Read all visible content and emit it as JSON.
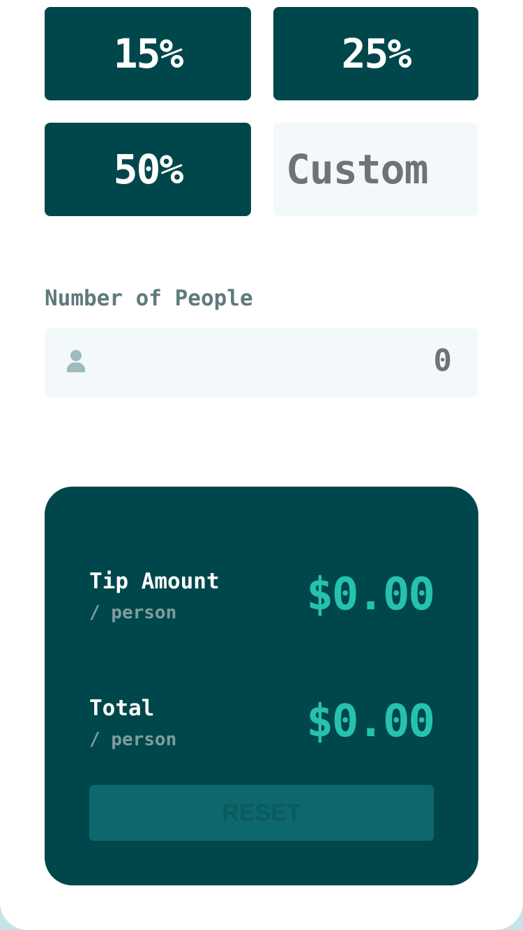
{
  "tips": {
    "options": [
      "15%",
      "25%",
      "50%"
    ],
    "custom_placeholder": "Custom"
  },
  "people": {
    "label": "Number of People",
    "value": "0",
    "icon": "person-icon"
  },
  "result": {
    "tip_label": "Tip Amount",
    "tip_sub": "/ person",
    "tip_value": "$0.00",
    "total_label": "Total",
    "total_sub": "/ person",
    "total_value": "$0.00",
    "reset_label": "RESET"
  },
  "colors": {
    "dark_cyan": "#00474b",
    "strong_cyan": "#26c2ad",
    "light_grayish_cyan": "#f3f9fa",
    "background": "#c5e4e7"
  }
}
